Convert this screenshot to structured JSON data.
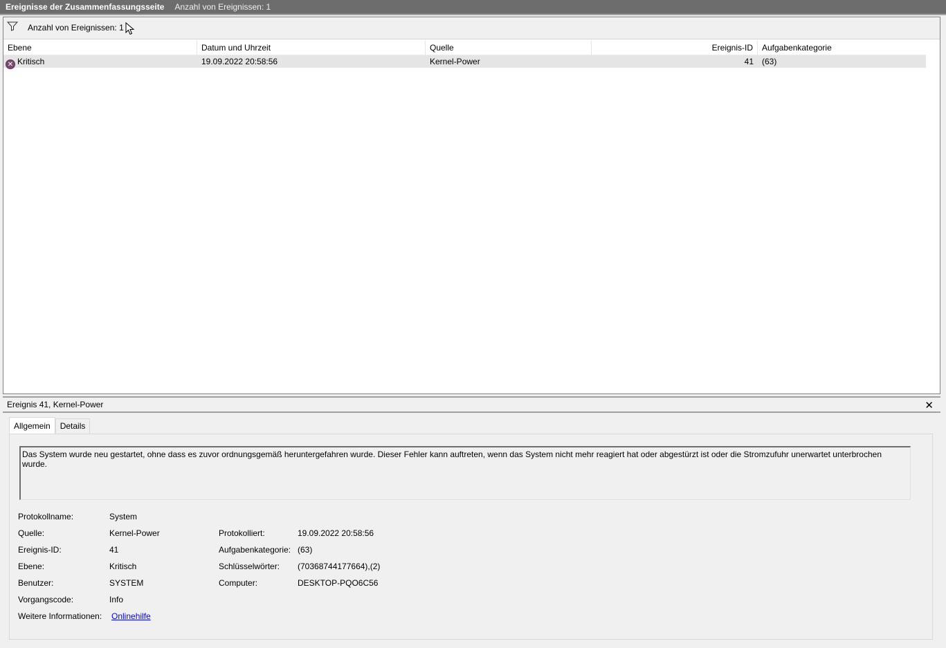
{
  "title": {
    "main": "Ereignisse der Zusammenfassungsseite",
    "count": "Anzahl von Ereignissen: 1"
  },
  "filter": {
    "label": "Anzahl von Ereignissen: 1",
    "icon": "filter-icon"
  },
  "grid": {
    "headers": [
      "Ebene",
      "Datum und Uhrzeit",
      "Quelle",
      "Ereignis-ID",
      "Aufgabenkategorie"
    ],
    "rows": [
      {
        "level": "Kritisch",
        "datetime": "19.09.2022 20:58:56",
        "source": "Kernel-Power",
        "event_id": "41",
        "category": "(63)"
      }
    ]
  },
  "detail": {
    "header": "Ereignis 41, Kernel-Power",
    "close_icon": "close-icon",
    "tabs": [
      "Allgemein",
      "Details"
    ],
    "description": "Das System wurde neu gestartet, ohne dass es zuvor ordnungsgemäß heruntergefahren wurde. Dieser Fehler kann auftreten, wenn das System nicht mehr reagiert hat oder abgestürzt ist oder die Stromzufuhr unerwartet unterbrochen wurde.",
    "left": [
      {
        "label": "Protokollname:",
        "value": "System"
      },
      {
        "label": "Quelle:",
        "value": "Kernel-Power"
      },
      {
        "label": "Ereignis-ID:",
        "value": "41"
      },
      {
        "label": "Ebene:",
        "value": "Kritisch"
      },
      {
        "label": "Benutzer:",
        "value": "SYSTEM"
      },
      {
        "label": "Vorgangscode:",
        "value": "Info"
      },
      {
        "label": "Weitere Informationen:",
        "value": "Onlinehilfe"
      }
    ],
    "right": [
      {
        "label": "Protokolliert:",
        "value": "19.09.2022 20:58:56"
      },
      {
        "label": "Aufgabenkategorie:",
        "value": "(63)"
      },
      {
        "label": "Schlüsselwörter:",
        "value": "(70368744177664),(2)"
      },
      {
        "label": "Computer:",
        "value": "DESKTOP-PQO6C56"
      }
    ]
  }
}
